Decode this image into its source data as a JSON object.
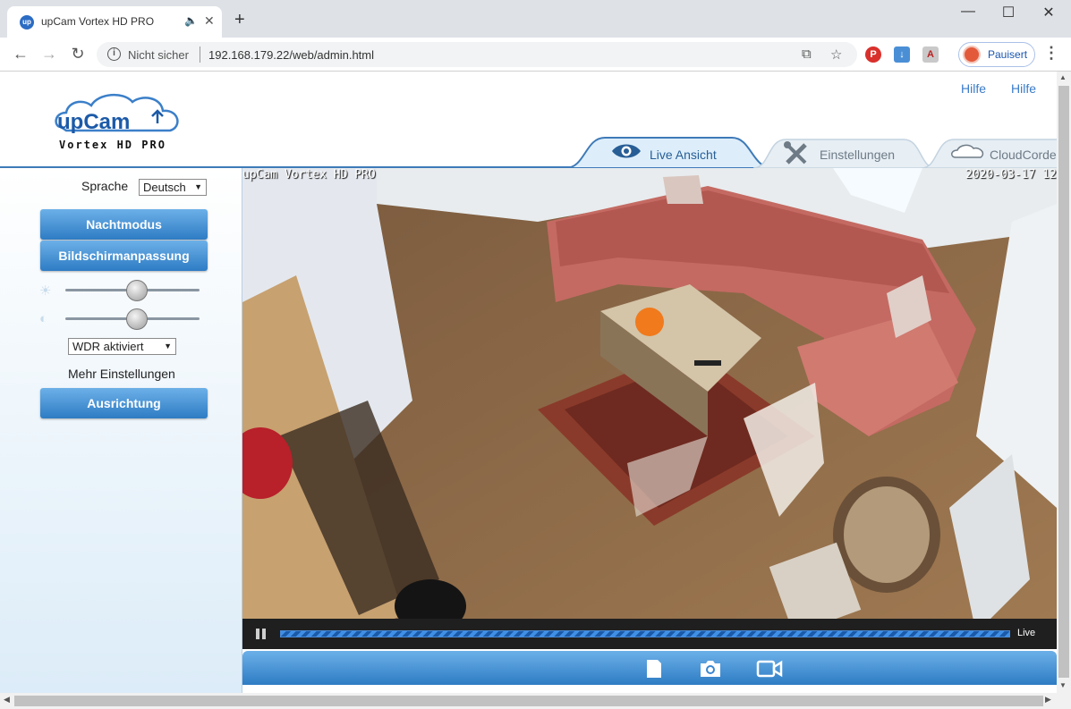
{
  "browser": {
    "tab_title": "upCam Vortex HD PRO",
    "new_tab": "+",
    "window_controls": [
      "—",
      "☐",
      "✕"
    ],
    "insecure_label": "Nicht sicher",
    "url": "192.168.179.22/web/admin.html",
    "profile_label": "Pauisert"
  },
  "header": {
    "logo_text": "upCam",
    "logo_subtext": "Vortex HD PRO",
    "help_links": [
      "Hilfe",
      "Hilfe"
    ],
    "tabs": [
      {
        "label": "Live Ansicht",
        "icon": "eye-icon",
        "active": true
      },
      {
        "label": "Einstellungen",
        "icon": "tools-icon",
        "active": false
      },
      {
        "label": "CloudCorde",
        "icon": "cloudcorder-icon",
        "active": false
      }
    ]
  },
  "sidebar": {
    "language_label": "Sprache",
    "language_value": "Deutsch",
    "night_mode_button": "Nachtmodus",
    "screen_adjust_button": "Bildschirmanpassung",
    "brightness_icon": "☀",
    "contrast_icon": "◐",
    "brightness_level": 0.53,
    "contrast_level": 0.53,
    "wdr_value": "WDR aktiviert",
    "more_settings_label": "Mehr Einstellungen",
    "orientation_button": "Ausrichtung"
  },
  "video": {
    "osd_name": "upCam Vortex HD PRO",
    "osd_time": "2020-03-17 12",
    "live_label": "Live",
    "progress": 1.0
  },
  "controls": [
    "sd-card-icon",
    "snapshot-camera-icon",
    "record-video-icon"
  ],
  "colors": {
    "accent": "#3a7bc8",
    "button_top": "#6cb0e8",
    "button_bottom": "#2e7cc4"
  }
}
